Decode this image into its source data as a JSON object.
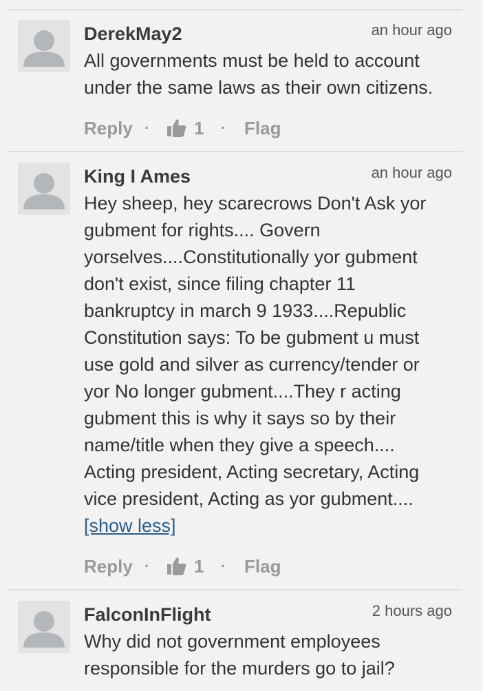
{
  "comments": [
    {
      "author": "DerekMay2",
      "time": "an hour ago",
      "lines": [
        "All governments must be held to account",
        "under the same laws as their own citizens."
      ],
      "reply_label": "Reply",
      "likes": "1",
      "flag_label": "Flag"
    },
    {
      "author": "King I Ames",
      "time": "an hour ago",
      "lines": [
        "Hey sheep, hey scarecrows Don't Ask yor",
        "gubment for rights.... Govern",
        "yorselves....Constitutionally yor gubment",
        "don't exist, since filing chapter 11",
        "bankruptcy in march 9 1933....Republic",
        "Constitution says: To be gubment u must",
        "use gold and silver as currency/tender or",
        "yor No longer gubment....They r acting",
        "gubment this is why it says so by their",
        "name/title when they give a speech....",
        "Acting president, Acting secretary, Acting",
        "vice president, Acting as yor gubment...."
      ],
      "show_less": "[show less]",
      "reply_label": "Reply",
      "likes": "1",
      "flag_label": "Flag"
    },
    {
      "author": "FalconInFlight",
      "time": "2 hours ago",
      "lines": [
        "Why did not government employees",
        "responsible for the murders go to jail?"
      ]
    }
  ],
  "icons": {
    "avatar": "default-user-avatar-icon",
    "like": "thumbs-up-icon"
  },
  "colors": {
    "background": "#f2f2f2",
    "link": "#2a5f8a",
    "muted": "#9a9a9a"
  }
}
